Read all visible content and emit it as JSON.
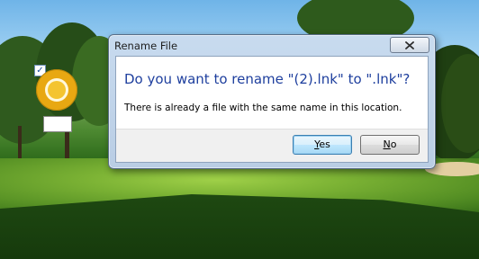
{
  "desktop": {
    "icon": {
      "name": "chrome-canary-icon",
      "checked": true,
      "label": ""
    }
  },
  "dialog": {
    "title": "Rename File",
    "main_instruction": "Do you want to rename \"(2).lnk\" to \".lnk\"?",
    "detail": "There is already a file with the same name in this location.",
    "buttons": {
      "yes": {
        "mnemonic": "Y",
        "rest": "es"
      },
      "no": {
        "mnemonic": "N",
        "rest": "o"
      }
    },
    "close_icon": "close-icon"
  },
  "colors": {
    "instruction_blue": "#1e3f9e",
    "default_button_border": "#3c7fb1"
  }
}
